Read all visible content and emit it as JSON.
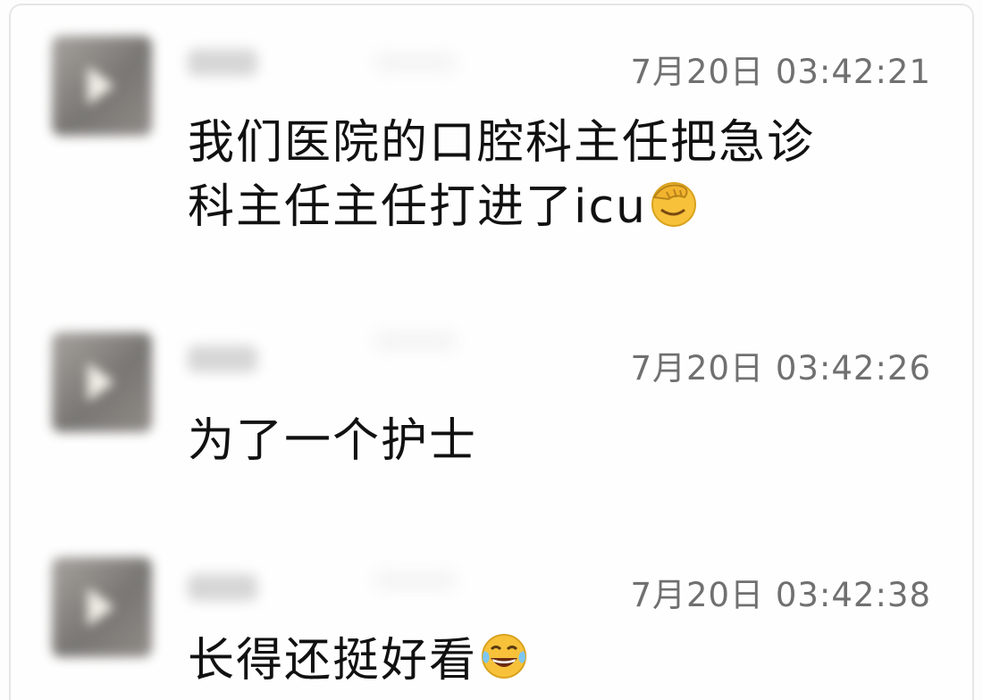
{
  "messages": [
    {
      "timestamp": "7月20日 03:42:21",
      "lines": [
        "我们医院的口腔科主任把急诊",
        "科主任主任打进了icu"
      ],
      "emoji": "facepalm-emoji"
    },
    {
      "timestamp": "7月20日 03:42:26",
      "lines": [
        "为了一个护士"
      ],
      "emoji": ""
    },
    {
      "timestamp": "7月20日 03:42:38",
      "lines": [
        "长得还挺好看"
      ],
      "emoji": "tears-of-joy-emoji"
    }
  ]
}
